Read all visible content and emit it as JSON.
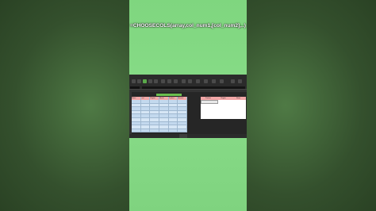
{
  "overlay": {
    "formula_text": "=CHOOSECOLS(array,col_num1,[col_num2],..)"
  },
  "excel": {
    "ribbon_tabs": [
      "File",
      "Home",
      "Insert",
      "Draw",
      "Page Layout",
      "Formulas",
      "Data",
      "Review",
      "View"
    ],
    "sheet_title_color": "#6bbf4e",
    "table": {
      "headers": [
        "Name",
        "Last",
        "Region",
        "Month",
        "Product",
        "Amount"
      ],
      "rows": [
        [
          "",
          "",
          "",
          "",
          "",
          ""
        ],
        [
          "",
          "",
          "",
          "",
          "",
          ""
        ],
        [
          "",
          "",
          "",
          "",
          "",
          ""
        ],
        [
          "",
          "",
          "",
          "",
          "",
          ""
        ],
        [
          "",
          "",
          "",
          "",
          "",
          ""
        ],
        [
          "",
          "",
          "",
          "",
          "",
          ""
        ],
        [
          "",
          "",
          "",
          "",
          "",
          ""
        ],
        [
          "",
          "",
          "",
          "",
          "",
          ""
        ],
        [
          "",
          "",
          "",
          "",
          "",
          ""
        ]
      ]
    },
    "output": {
      "headers": [
        "Product",
        "Region",
        "Name"
      ]
    },
    "sheet_tabs": [
      "Sheet1",
      "Sheet2",
      "Sheet3",
      "Sheet4",
      "Sheet5",
      "Sheet6",
      "Sheet7"
    ]
  },
  "colors": {
    "center_panel": "#86d986",
    "side_background": "#3c5a34",
    "table_header": "#f2a7a7",
    "table_row": "#d6e6f5"
  }
}
